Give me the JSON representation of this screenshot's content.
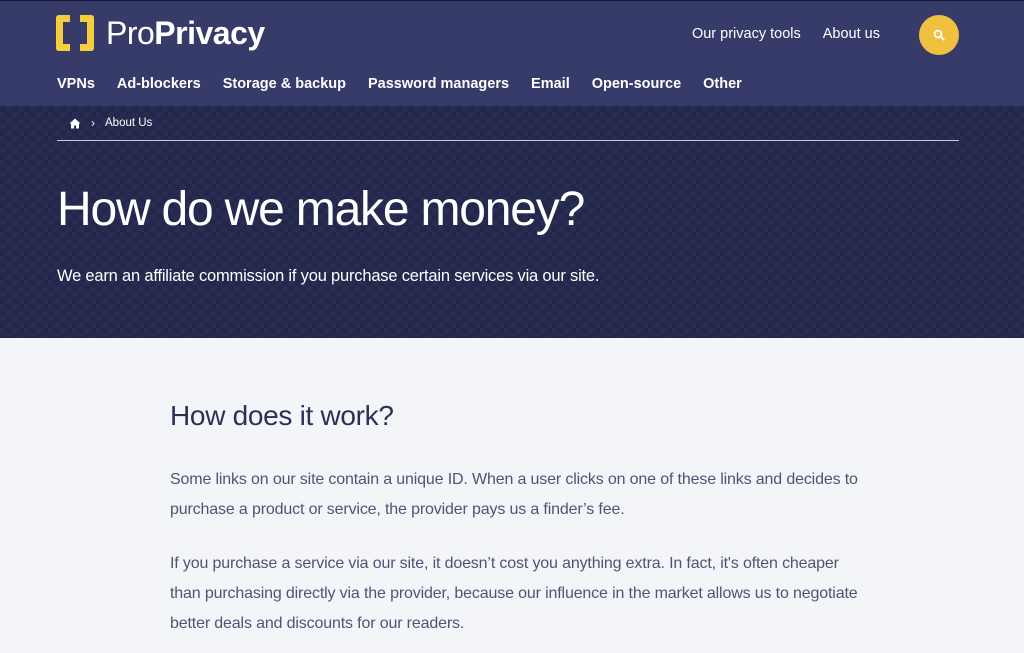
{
  "header": {
    "logo": {
      "light": "Pro",
      "bold": "Privacy"
    },
    "top_links": [
      "Our privacy tools",
      "About us"
    ],
    "search_icon": "search-icon",
    "nav": [
      "VPNs",
      "Ad-blockers",
      "Storage & backup",
      "Password managers",
      "Email",
      "Open-source",
      "Other"
    ]
  },
  "hero": {
    "breadcrumb": {
      "home_icon": "home-icon",
      "current": "About Us"
    },
    "title": "How do we make money?",
    "subtitle": "We earn an affiliate commission if you purchase certain services via our site."
  },
  "content": {
    "heading": "How does it work?",
    "paragraphs": [
      "Some links on our site contain a unique ID. When a user clicks on one of these links and decides to purchase a product or service, the provider pays us a finder’s fee.",
      "If you purchase a service via our site, it doesn’t cost you anything extra. In fact, it's often cheaper than purchasing directly via the provider, because our influence in the market allows us to negotiate better deals and discounts for our readers."
    ]
  },
  "colors": {
    "header_bg": "#373b6a",
    "hero_bg": "#23274c",
    "accent": "#f0c040",
    "page_bg": "#f3f5f9",
    "heading_text": "#2c3056",
    "body_text": "#4f5474"
  }
}
